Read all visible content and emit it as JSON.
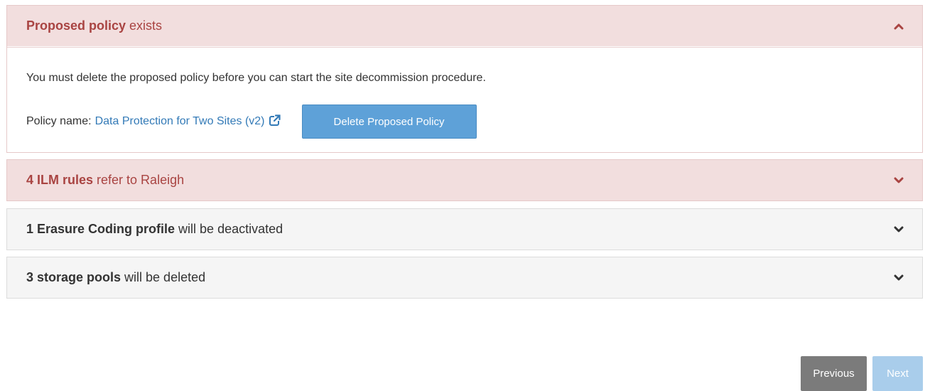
{
  "panels": {
    "proposed_policy": {
      "title_strong": "Proposed policy",
      "title_rest": " exists",
      "expanded": true,
      "chevron_icon": "chevron-up-icon",
      "message": "You must delete the proposed policy before you can start the site decommission procedure.",
      "policy_label": "Policy name:",
      "policy_link": "Data Protection for Two Sites (v2)",
      "link_icon": "external-link-icon",
      "delete_button": "Delete Proposed Policy"
    },
    "ilm_rules": {
      "title_strong": "4 ILM rules",
      "title_rest": " refer to Raleigh",
      "expanded": false,
      "chevron_icon": "chevron-down-icon"
    },
    "erasure_coding": {
      "title_strong": "1 Erasure Coding profile",
      "title_rest": " will be deactivated",
      "expanded": false,
      "chevron_icon": "chevron-down-icon"
    },
    "storage_pools": {
      "title_strong": "3 storage pools",
      "title_rest": " will be deleted",
      "expanded": false,
      "chevron_icon": "chevron-down-icon"
    }
  },
  "footer": {
    "previous_label": "Previous",
    "next_label": "Next",
    "next_disabled": true
  },
  "colors": {
    "danger_bg": "#f2dede",
    "danger_text": "#a94442",
    "link": "#337ab7",
    "primary_button": "#5ea1d8",
    "secondary_button": "#7b7b7b",
    "disabled_button": "#a9cdeb"
  }
}
